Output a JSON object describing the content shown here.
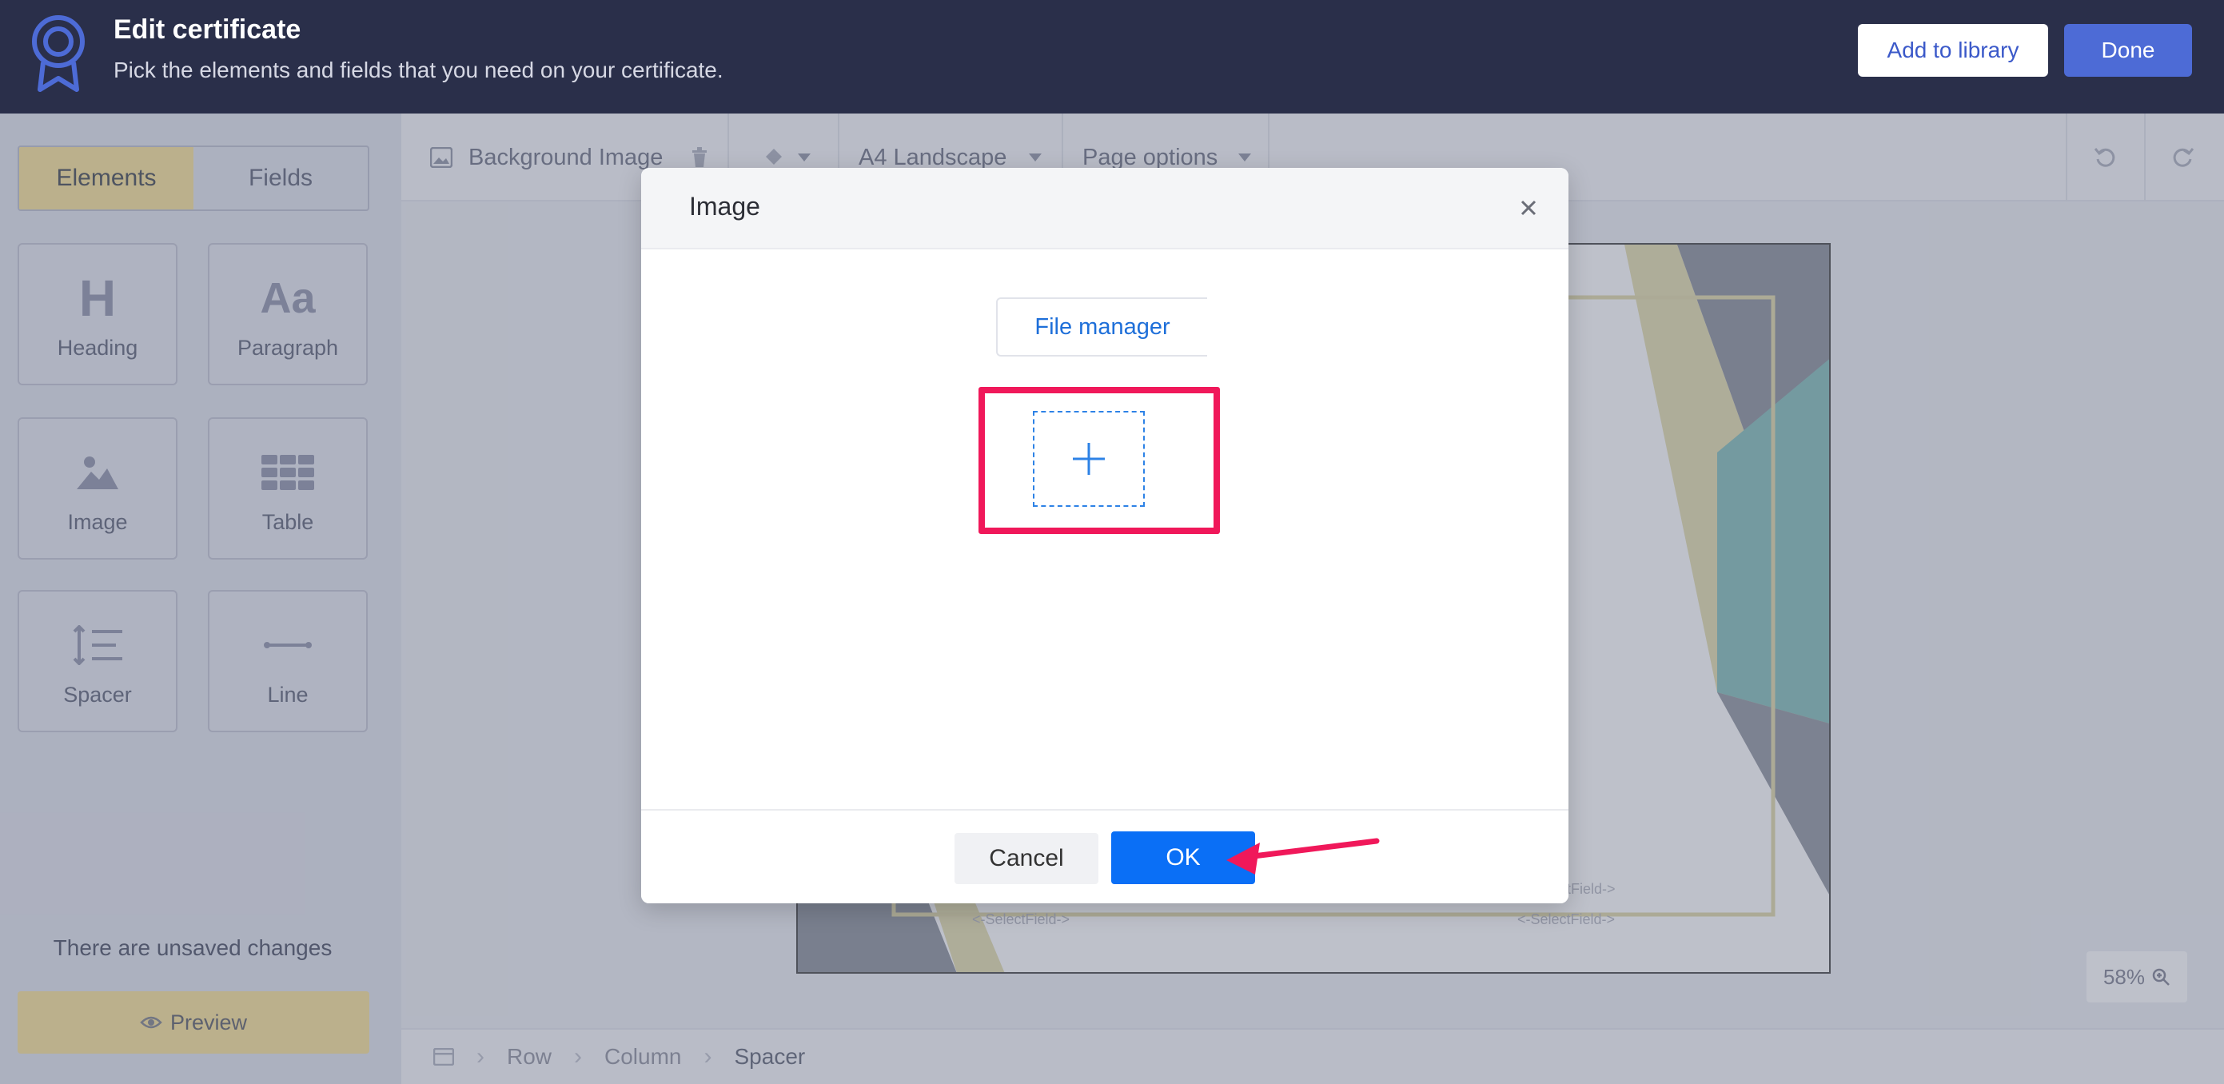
{
  "header": {
    "title": "Edit certificate",
    "subtitle": "Pick the elements and fields that you need on your certificate.",
    "add_to_library": "Add to library",
    "done": "Done",
    "badge_icon": "award-badge-icon"
  },
  "sidebar": {
    "tabs": [
      "Elements",
      "Fields"
    ],
    "elements": [
      {
        "label": "Heading",
        "icon": "heading-icon"
      },
      {
        "label": "Paragraph",
        "icon": "paragraph-icon"
      },
      {
        "label": "Image",
        "icon": "image-icon"
      },
      {
        "label": "Table",
        "icon": "table-icon"
      },
      {
        "label": "Spacer",
        "icon": "spacer-icon"
      },
      {
        "label": "Line",
        "icon": "line-icon"
      }
    ],
    "unsaved": "There are unsaved changes",
    "preview": "Preview"
  },
  "toolbar": {
    "background_image": "Background Image",
    "page_size": "A4 Landscape",
    "page_options": "Page options"
  },
  "canvas": {
    "field_placeholder_1": "<-SelectField->",
    "field_placeholder_2": "<-SelectField->",
    "field_placeholder_3": "tField->",
    "zoom": "58%"
  },
  "breadcrumb": [
    "Row",
    "Column",
    "Spacer"
  ],
  "modal": {
    "title": "Image",
    "file_manager": "File manager",
    "cancel": "Cancel",
    "ok": "OK"
  },
  "colors": {
    "header_bg": "#2a2f4a",
    "accent_blue": "#0a6ff6",
    "highlight_pink": "#f0185a",
    "tab_yellow": "#fbe5a0"
  }
}
